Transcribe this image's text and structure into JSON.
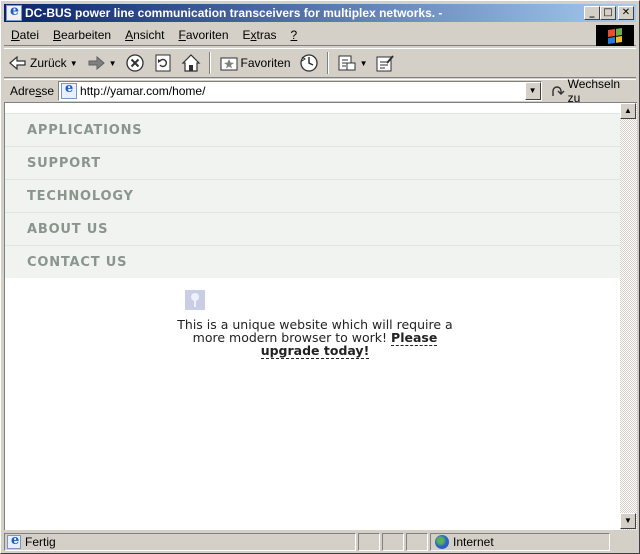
{
  "window": {
    "title": "DC-BUS power line communication transceivers for multiplex networks. -",
    "buttons": {
      "minimize": "_",
      "maximize": "□",
      "close": "✕"
    }
  },
  "menu": {
    "items": [
      {
        "label": "Datei",
        "hotkey": "D",
        "rest": "atei"
      },
      {
        "label": "Bearbeiten",
        "hotkey": "B",
        "rest": "earbeiten"
      },
      {
        "label": "Ansicht",
        "hotkey": "A",
        "rest": "nsicht"
      },
      {
        "label": "Favoriten",
        "hotkey": "F",
        "rest": "avoriten"
      },
      {
        "label": "Extras",
        "pre": "E",
        "hotkey": "x",
        "rest": "tras"
      },
      {
        "label": "?",
        "hotkey": "?",
        "rest": ""
      }
    ]
  },
  "toolbar": {
    "back_label": "Zurück",
    "favorites_label": "Favoriten",
    "icons": [
      "back-arrow-icon",
      "forward-arrow-icon",
      "stop-icon",
      "refresh-icon",
      "home-icon",
      "favorites-star-icon",
      "history-icon",
      "mail-icon",
      "edit-icon"
    ]
  },
  "address": {
    "label_pre": "Adre",
    "label_hotkey": "s",
    "label_post": "se",
    "url": "http://yamar.com/home/",
    "go_label": "Wechseln zu"
  },
  "page": {
    "nav": [
      "APPLICATIONS",
      "SUPPORT",
      "TECHNOLOGY",
      "ABOUT US",
      "CONTACT US"
    ],
    "notice_text": "This is a unique website which will require a more modern browser to work!",
    "upgrade_link": "Please upgrade today!"
  },
  "status": {
    "text": "Fertig",
    "zone": "Internet"
  },
  "colors": {
    "titlebar_start": "#0a246a",
    "titlebar_end": "#a6caf0",
    "nav_text": "#8a958d",
    "nav_bg": "#f0f3f0"
  }
}
